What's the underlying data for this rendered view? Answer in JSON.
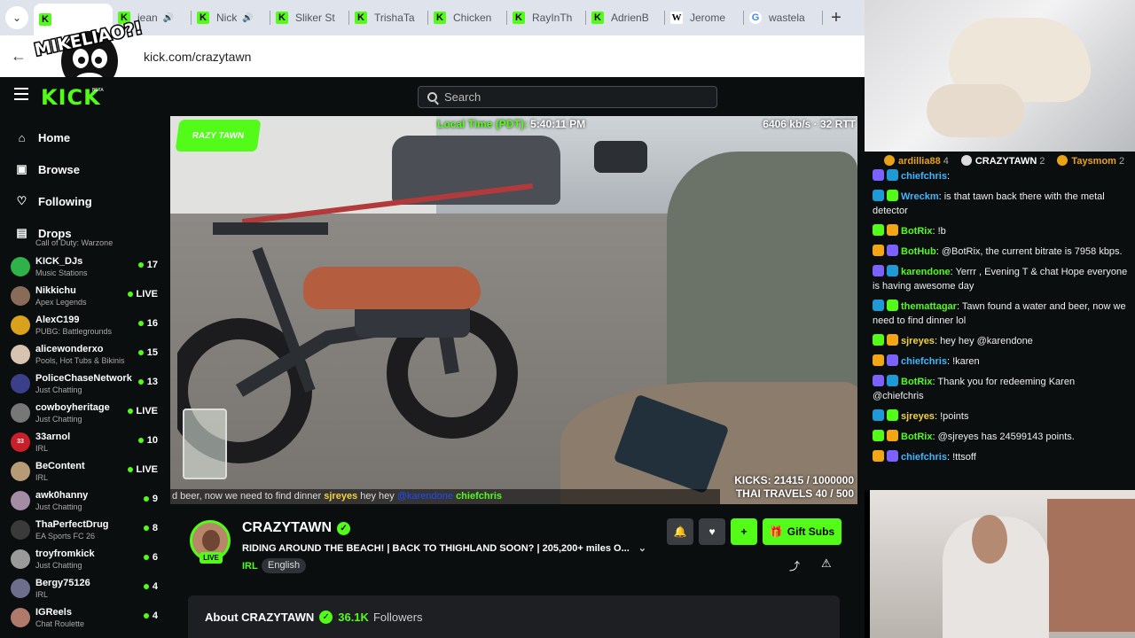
{
  "browser": {
    "tabs": [
      {
        "label": "",
        "favicon": "kick",
        "active": true
      },
      {
        "label": "jean",
        "favicon": "kick",
        "audio": true
      },
      {
        "label": "Nick",
        "favicon": "kick",
        "audio": true
      },
      {
        "label": "Sliker St",
        "favicon": "kick"
      },
      {
        "label": "TrishaTa",
        "favicon": "kick"
      },
      {
        "label": "Chicken",
        "favicon": "kick"
      },
      {
        "label": "RayInTh",
        "favicon": "kick"
      },
      {
        "label": "AdrienB",
        "favicon": "kick"
      },
      {
        "label": "Jerome",
        "favicon": "wikipedia"
      },
      {
        "label": "wastela",
        "favicon": "google"
      }
    ],
    "url": "kick.com/crazytawn",
    "overlay_logo_text": "MIKELIAO?!"
  },
  "header": {
    "logo": "KICK",
    "logo_badge": "BETA",
    "search_placeholder": "Search"
  },
  "sidebar": {
    "nav": [
      {
        "label": "Home",
        "icon": "home-icon"
      },
      {
        "label": "Browse",
        "icon": "browse-icon"
      },
      {
        "label": "Following",
        "icon": "heart-icon"
      },
      {
        "label": "Drops",
        "icon": "drops-icon"
      }
    ],
    "cut_text": "Call of Duty: Warzone",
    "channels": [
      {
        "name": "KICK_DJs",
        "category": "Music Stations",
        "count": "17",
        "avatar_color": "#2fb24a"
      },
      {
        "name": "Nikkichu",
        "category": "Apex Legends",
        "count": "LIVE",
        "avatar_color": "#8a6b5a"
      },
      {
        "name": "AlexC199",
        "category": "PUBG: Battlegrounds",
        "count": "16",
        "avatar_color": "#d9a21c"
      },
      {
        "name": "alicewonderxo",
        "category": "Pools, Hot Tubs & Bikinis",
        "count": "15",
        "avatar_color": "#d8c2b0"
      },
      {
        "name": "PoliceChaseNetwork",
        "category": "Just Chatting",
        "count": "13",
        "avatar_color": "#3b3f8a"
      },
      {
        "name": "cowboyheritage",
        "category": "Just Chatting",
        "count": "LIVE",
        "avatar_color": "#777"
      },
      {
        "name": "33arnol",
        "category": "IRL",
        "count": "10",
        "avatar_color": "#c7202a",
        "avatar_text": "33"
      },
      {
        "name": "BeContent",
        "category": "IRL",
        "count": "LIVE",
        "avatar_color": "#b79a76"
      },
      {
        "name": "awk0hanny",
        "category": "Just Chatting",
        "count": "9",
        "avatar_color": "#a38da5"
      },
      {
        "name": "ThaPerfectDrug",
        "category": "EA Sports FC 26",
        "count": "8",
        "avatar_color": "#3a3a3a"
      },
      {
        "name": "troyfromkick",
        "category": "Just Chatting",
        "count": "6",
        "avatar_color": "#9a9a9a"
      },
      {
        "name": "Bergy75126",
        "category": "IRL",
        "count": "4",
        "avatar_color": "#6d6d8c"
      },
      {
        "name": "IGReels",
        "category": "Chat Roulette",
        "count": "4",
        "avatar_color": "#b07a6a"
      }
    ]
  },
  "player": {
    "overlay_logo": "RAZY TAWN",
    "local_time_label": "Local Time (PDT):",
    "local_time": "5:40:11 PM",
    "bitrate": "6406 kb/s · 32 RTT",
    "kicks": "KICKS: 21415 / 1000000",
    "thai_travels": "THAI TRAVELS 40 / 500",
    "ticker": {
      "lead": "d beer, now we need to find dinner",
      "user1": "sjreyes",
      "text1": "hey hey",
      "mention": "@karendone",
      "user2": "chiefchris"
    }
  },
  "channel": {
    "name": "CRAZYTAWN",
    "live": "LIVE",
    "title": "RIDING AROUND THE BEACH! | BACK TO THIGHLAND SOON? | 205,200+ miles O...",
    "category": "IRL",
    "tag": "English",
    "gift_label": "Gift Subs",
    "about_label": "About CRAZYTAWN",
    "followers_count": "36.1K",
    "followers_label": "Followers"
  },
  "chat": {
    "leaderboard": [
      {
        "name": "ardillia88",
        "count": "4",
        "color": "#e8a317"
      },
      {
        "name": "CRAZYTAWN",
        "count": "2",
        "color": "#ddd"
      },
      {
        "name": "Taysmom",
        "count": "2",
        "color": "#e8a317"
      }
    ],
    "messages": [
      {
        "user": "chiefchris",
        "text": "",
        "color": "#3db8ff"
      },
      {
        "user": "Wreckm",
        "text": "is that tawn back there with the metal detector",
        "color": "#3db8ff"
      },
      {
        "user": "BotRix",
        "text": "!b",
        "color": "#53fc18"
      },
      {
        "user": "BotHub",
        "text": "@BotRix, the current bitrate is 7958 kbps.",
        "color": "#53fc18"
      },
      {
        "user": "karendone",
        "text": "Yerrr , Evening T & chat Hope everyone is having awesome day",
        "color": "#53fc18"
      },
      {
        "user": "themattagar",
        "text": "Tawn found a water and beer, now we need to find dinner lol",
        "color": "#53fc18"
      },
      {
        "user": "sjreyes",
        "text": "hey hey @karendone",
        "color": "#f2d33a"
      },
      {
        "user": "chiefchris",
        "text": "!karen",
        "color": "#3db8ff"
      },
      {
        "user": "BotRix",
        "text": "Thank you for redeeming Karen @chiefchris",
        "color": "#53fc18"
      },
      {
        "user": "sjreyes",
        "text": "!points",
        "color": "#f2d33a"
      },
      {
        "user": "BotRix",
        "text": "@sjreyes has 24599143 points.",
        "color": "#53fc18"
      },
      {
        "user": "chiefchris",
        "text": "!ttsoff",
        "color": "#3db8ff"
      }
    ]
  }
}
